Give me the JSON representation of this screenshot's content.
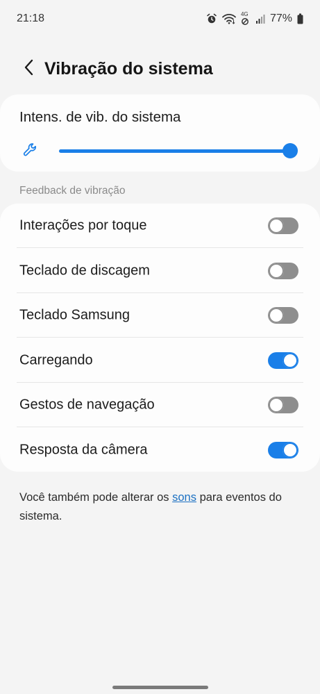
{
  "status_bar": {
    "time": "21:18",
    "network_label": "4G",
    "battery_text": "77%",
    "icons": [
      "alarm-icon",
      "wifi-icon",
      "data-saver-icon",
      "signal-icon",
      "battery-icon"
    ]
  },
  "header": {
    "title": "Vibração do sistema",
    "back_icon": "chevron-left-icon"
  },
  "intensity": {
    "label": "Intens. de vib. do sistema",
    "icon": "wrench-icon",
    "level": 1.0
  },
  "section": {
    "title": "Feedback de vibração"
  },
  "items": [
    {
      "label": "Interações por toque",
      "on": false
    },
    {
      "label": "Teclado de discagem",
      "on": false
    },
    {
      "label": "Teclado Samsung",
      "on": false
    },
    {
      "label": "Carregando",
      "on": true
    },
    {
      "label": "Gestos de navegação",
      "on": false
    },
    {
      "label": "Resposta da câmera",
      "on": true
    }
  ],
  "footer": {
    "before": "Você também pode alterar os ",
    "link": "sons",
    "after": " para eventos do sistema."
  },
  "colors": {
    "accent": "#1a7fe8",
    "toggle_off": "#8e8e8e",
    "link": "#1b70c2",
    "background": "#f4f4f4",
    "card": "#fdfdfd"
  }
}
